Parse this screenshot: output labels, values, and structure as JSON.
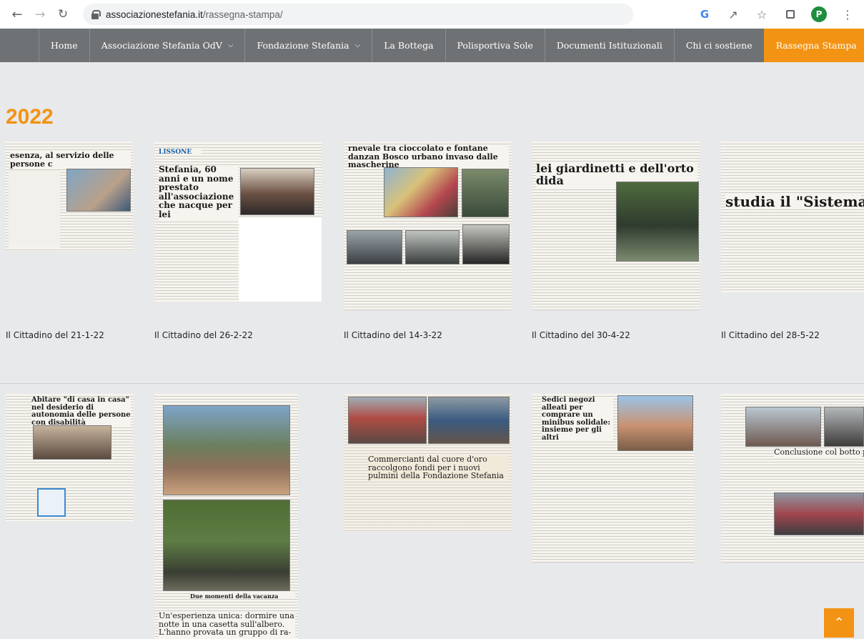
{
  "browser": {
    "url_domain": "associazionestefania.it",
    "url_path": "/rassegna-stampa/",
    "profile_initial": "P",
    "google_letter": "G"
  },
  "nav": {
    "items": [
      {
        "label": "Home",
        "has_dropdown": false,
        "active": false
      },
      {
        "label": "Associazione Stefania OdV",
        "has_dropdown": true,
        "active": false
      },
      {
        "label": "Fondazione Stefania",
        "has_dropdown": true,
        "active": false
      },
      {
        "label": "La Bottega",
        "has_dropdown": false,
        "active": false
      },
      {
        "label": "Polisportiva Sole",
        "has_dropdown": false,
        "active": false
      },
      {
        "label": "Documenti Istituzionali",
        "has_dropdown": false,
        "active": false
      },
      {
        "label": "Chi ci sostiene",
        "has_dropdown": false,
        "active": false
      },
      {
        "label": "Rassegna Stampa",
        "has_dropdown": false,
        "active": true
      }
    ],
    "active_color": "#f39313"
  },
  "main": {
    "year": "2022",
    "row1": [
      {
        "caption": "Il Cittadino del 21-1-22",
        "headline": "esenza, al servizio delle persone c"
      },
      {
        "caption": "Il Cittadino del 26-2-22",
        "headline": "Stefania, 60 anni e un nome prestato all'associazione che nacque per lei",
        "section": "LISSONE"
      },
      {
        "caption": "Il Cittadino del 14-3-22",
        "headline": "rnevale tra cioccolato e fontane danzan Bosco urbano invaso dalle mascherine"
      },
      {
        "caption": "Il Cittadino del 30-4-22",
        "headline": "lei giardinetti e dell'orto dida"
      },
      {
        "caption": "Il Cittadino del 28-5-22",
        "headline": "studia il \"Sistema"
      }
    ],
    "row2": [
      {
        "headline": "Abitare \"di casa in casa\" nel desiderio di autonomia delle persone con disabilità"
      },
      {
        "headline": "Due momenti della vacanza",
        "subhead": "Un'esperienza unica: dormire una notte in una casetta sull'albero. L'hanno provata un gruppo di ra-"
      },
      {
        "headline": "Commercianti dal cuore d'oro raccolgono fondi per i nuovi pulmini della Fondazione Stefania"
      },
      {
        "headline": "Sedici negozi alleati per comprare un minibus solidale: insieme per gli altri"
      },
      {
        "headline": "Conclusione col botto per la S Muggiò si è riscoperta bella e"
      }
    ]
  },
  "scroll_top_icon": "double-chevron-up-icon"
}
